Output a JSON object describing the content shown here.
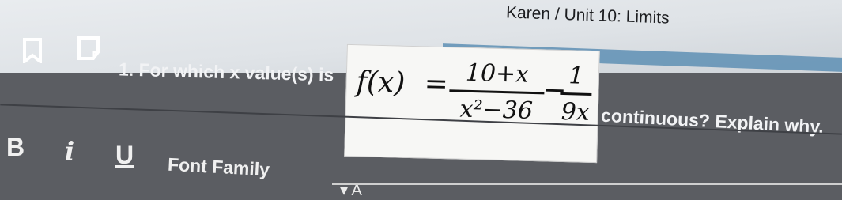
{
  "header": {
    "breadcrumb": "Karen / Unit 10: Limits"
  },
  "question": {
    "prefix": "1. For which x value(s) is",
    "suffix": "continuous? Explain why.",
    "formula": {
      "lhs": "f(x)",
      "equals": "=",
      "frac1_num": "10+x",
      "frac1_den": "x²−36",
      "minus": "−",
      "frac2_num": "1",
      "frac2_den": "9x"
    }
  },
  "toolbar": {
    "bold_label": "B",
    "italic_label": "i",
    "underline_label": "U",
    "font_family_label": "Font Family",
    "font_size_label": "▾ A"
  },
  "icons": {
    "bookmark": "bookmark-icon",
    "flag": "flag-icon"
  }
}
